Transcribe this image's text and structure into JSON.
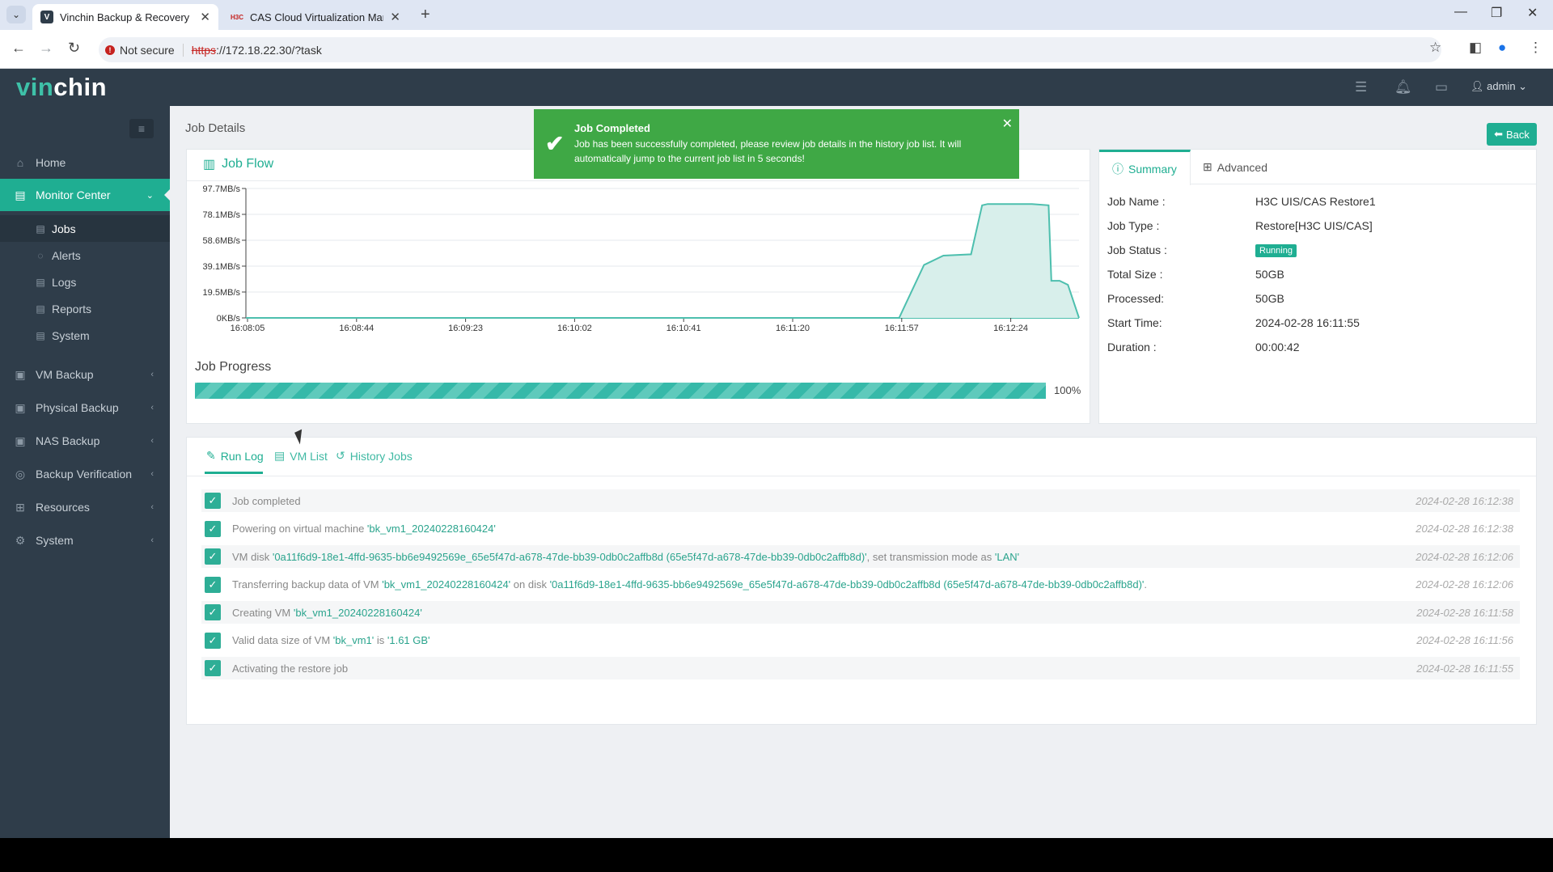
{
  "browser": {
    "tabs": [
      {
        "title": "Vinchin Backup & Recovery",
        "favicon": "V",
        "active": true
      },
      {
        "title": "CAS Cloud Virtualization Mana",
        "favicon": "H3C",
        "active": false
      }
    ],
    "not_secure_label": "Not secure",
    "url_scheme": "https",
    "url_rest": "://172.18.22.30/?task"
  },
  "app": {
    "logo_part1": "vin",
    "logo_part2": "chin",
    "user": "admin"
  },
  "sidebar": {
    "items": [
      {
        "label": "Home",
        "icon": "home-icon"
      },
      {
        "label": "Monitor Center",
        "icon": "monitor-icon",
        "active": true
      },
      {
        "label": "VM Backup",
        "icon": "vm-icon"
      },
      {
        "label": "Physical Backup",
        "icon": "server-icon"
      },
      {
        "label": "NAS Backup",
        "icon": "nas-icon"
      },
      {
        "label": "Backup Verification",
        "icon": "verify-icon"
      },
      {
        "label": "Resources",
        "icon": "resources-icon"
      },
      {
        "label": "System",
        "icon": "system-icon"
      }
    ],
    "subitems": [
      {
        "label": "Jobs",
        "active": true
      },
      {
        "label": "Alerts"
      },
      {
        "label": "Logs"
      },
      {
        "label": "Reports"
      },
      {
        "label": "System"
      }
    ]
  },
  "page": {
    "breadcrumb": "Job Details",
    "back_label": "Back"
  },
  "toast": {
    "title": "Job Completed",
    "message": "Job has been successfully completed, please review job details in the history job list. It will automatically jump to the current job list in 5 seconds!"
  },
  "job_flow": {
    "title": "Job Flow",
    "progress_title": "Job Progress",
    "progress_value": 100,
    "progress_text": "100%"
  },
  "chart_data": {
    "type": "area",
    "y_ticks": [
      "0KB/s",
      "19.5MB/s",
      "39.1MB/s",
      "58.6MB/s",
      "78.1MB/s",
      "97.7MB/s"
    ],
    "x_ticks": [
      "16:08:05",
      "16:08:44",
      "16:09:23",
      "16:10:02",
      "16:10:41",
      "16:11:20",
      "16:11:57",
      "16:12:24"
    ],
    "ylim": [
      0,
      97.7
    ],
    "x_seconds": [
      0,
      236,
      245,
      252,
      262,
      266,
      268,
      284,
      290,
      291,
      294,
      297,
      301
    ],
    "values_mbps": [
      0,
      0,
      40,
      47,
      48,
      85,
      86,
      86,
      85,
      28,
      28,
      25,
      0
    ],
    "color": "#4dbfae",
    "grid": true
  },
  "summary": {
    "tabs": [
      {
        "label": "Summary"
      },
      {
        "label": "Advanced"
      }
    ],
    "fields": [
      {
        "label": "Job Name :",
        "value": "H3C UIS/CAS Restore1"
      },
      {
        "label": "Job Type :",
        "value": "Restore[H3C UIS/CAS]"
      },
      {
        "label": "Job Status :",
        "value": "Running"
      },
      {
        "label": "Total Size :",
        "value": "50GB"
      },
      {
        "label": "Processed:",
        "value": "50GB"
      },
      {
        "label": "Start Time:",
        "value": "2024-02-28 16:11:55"
      },
      {
        "label": "Duration :",
        "value": "00:00:42"
      }
    ]
  },
  "log": {
    "tabs": [
      {
        "label": "Run Log"
      },
      {
        "label": "VM List"
      },
      {
        "label": "History Jobs"
      }
    ],
    "rows": [
      {
        "pre": "Job completed",
        "hl": "",
        "post": "",
        "hl2": "",
        "post2": "",
        "time": "2024-02-28 16:12:38"
      },
      {
        "pre": "Powering on virtual machine ",
        "hl": "'bk_vm1_20240228160424'",
        "post": "",
        "hl2": "",
        "post2": "",
        "time": "2024-02-28 16:12:38"
      },
      {
        "pre": "VM disk ",
        "hl": "'0a11f6d9-18e1-4ffd-9635-bb6e9492569e_65e5f47d-a678-47de-bb39-0db0c2affb8d (65e5f47d-a678-47de-bb39-0db0c2affb8d)'",
        "post": ", set transmission mode as ",
        "hl2": "'LAN'",
        "post2": "",
        "time": "2024-02-28 16:12:06"
      },
      {
        "pre": "Transferring backup data of VM ",
        "hl": "'bk_vm1_20240228160424'",
        "post": " on disk ",
        "hl2": "'0a11f6d9-18e1-4ffd-9635-bb6e9492569e_65e5f47d-a678-47de-bb39-0db0c2affb8d (65e5f47d-a678-47de-bb39-0db0c2affb8d)'",
        "post2": ".",
        "time": "2024-02-28 16:12:06"
      },
      {
        "pre": "Creating VM ",
        "hl": "'bk_vm1_20240228160424'",
        "post": "",
        "hl2": "",
        "post2": "",
        "time": "2024-02-28 16:11:58"
      },
      {
        "pre": "Valid data size of VM ",
        "hl": "'bk_vm1'",
        "post": " is ",
        "hl2": "'1.61 GB'",
        "post2": "",
        "time": "2024-02-28 16:11:56"
      },
      {
        "pre": "Activating the restore job",
        "hl": "",
        "post": "",
        "hl2": "",
        "post2": "",
        "time": "2024-02-28 16:11:55"
      }
    ]
  }
}
